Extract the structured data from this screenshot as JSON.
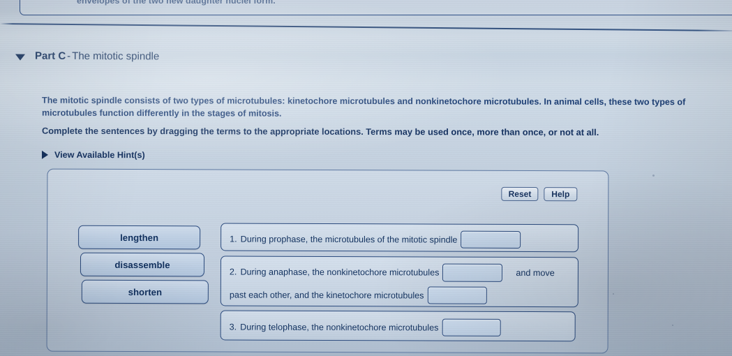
{
  "previous_part": {
    "truncated_text": "envelopes of the two new daughter nuclei form."
  },
  "part": {
    "caret": "caret-down-icon",
    "label": "Part C",
    "dash": "-",
    "name": "The mitotic spindle"
  },
  "question": {
    "body": "The mitotic spindle consists of two types of microtubules: kinetochore microtubules and nonkinetochore microtubules. In animal cells, these two types of microtubules function differently in the stages of mitosis.",
    "instruction": "Complete the sentences by dragging the terms to the appropriate locations. Terms may be used once, more than once, or not at all."
  },
  "hints": {
    "caret": "caret-right-icon",
    "label": "View Available Hint(s)"
  },
  "toolbar": {
    "reset_label": "Reset",
    "help_label": "Help"
  },
  "term_bank": [
    {
      "label": "lengthen"
    },
    {
      "label": "disassemble"
    },
    {
      "label": "shorten"
    }
  ],
  "statements": [
    {
      "number": "1.",
      "lead": "During prophase, the microtubules of the mitotic spindle",
      "dropzone_value": "",
      "trail": ""
    },
    {
      "number": "2.",
      "lead": "During anaphase, the nonkinetochore microtubules",
      "dropzone_value": "",
      "trail": "and move",
      "second_line_lead": "past each other, and the kinetochore microtubules",
      "second_dropzone_value": ""
    },
    {
      "number": "3.",
      "lead": "During telophase, the nonkinetochore microtubules",
      "dropzone_value": "",
      "trail": ""
    }
  ],
  "colors": {
    "text_blue": "#10305e",
    "border_blue": "#2a4a7e",
    "panel_border": "#5e79a3",
    "term_fill": "#bfd0e4"
  }
}
